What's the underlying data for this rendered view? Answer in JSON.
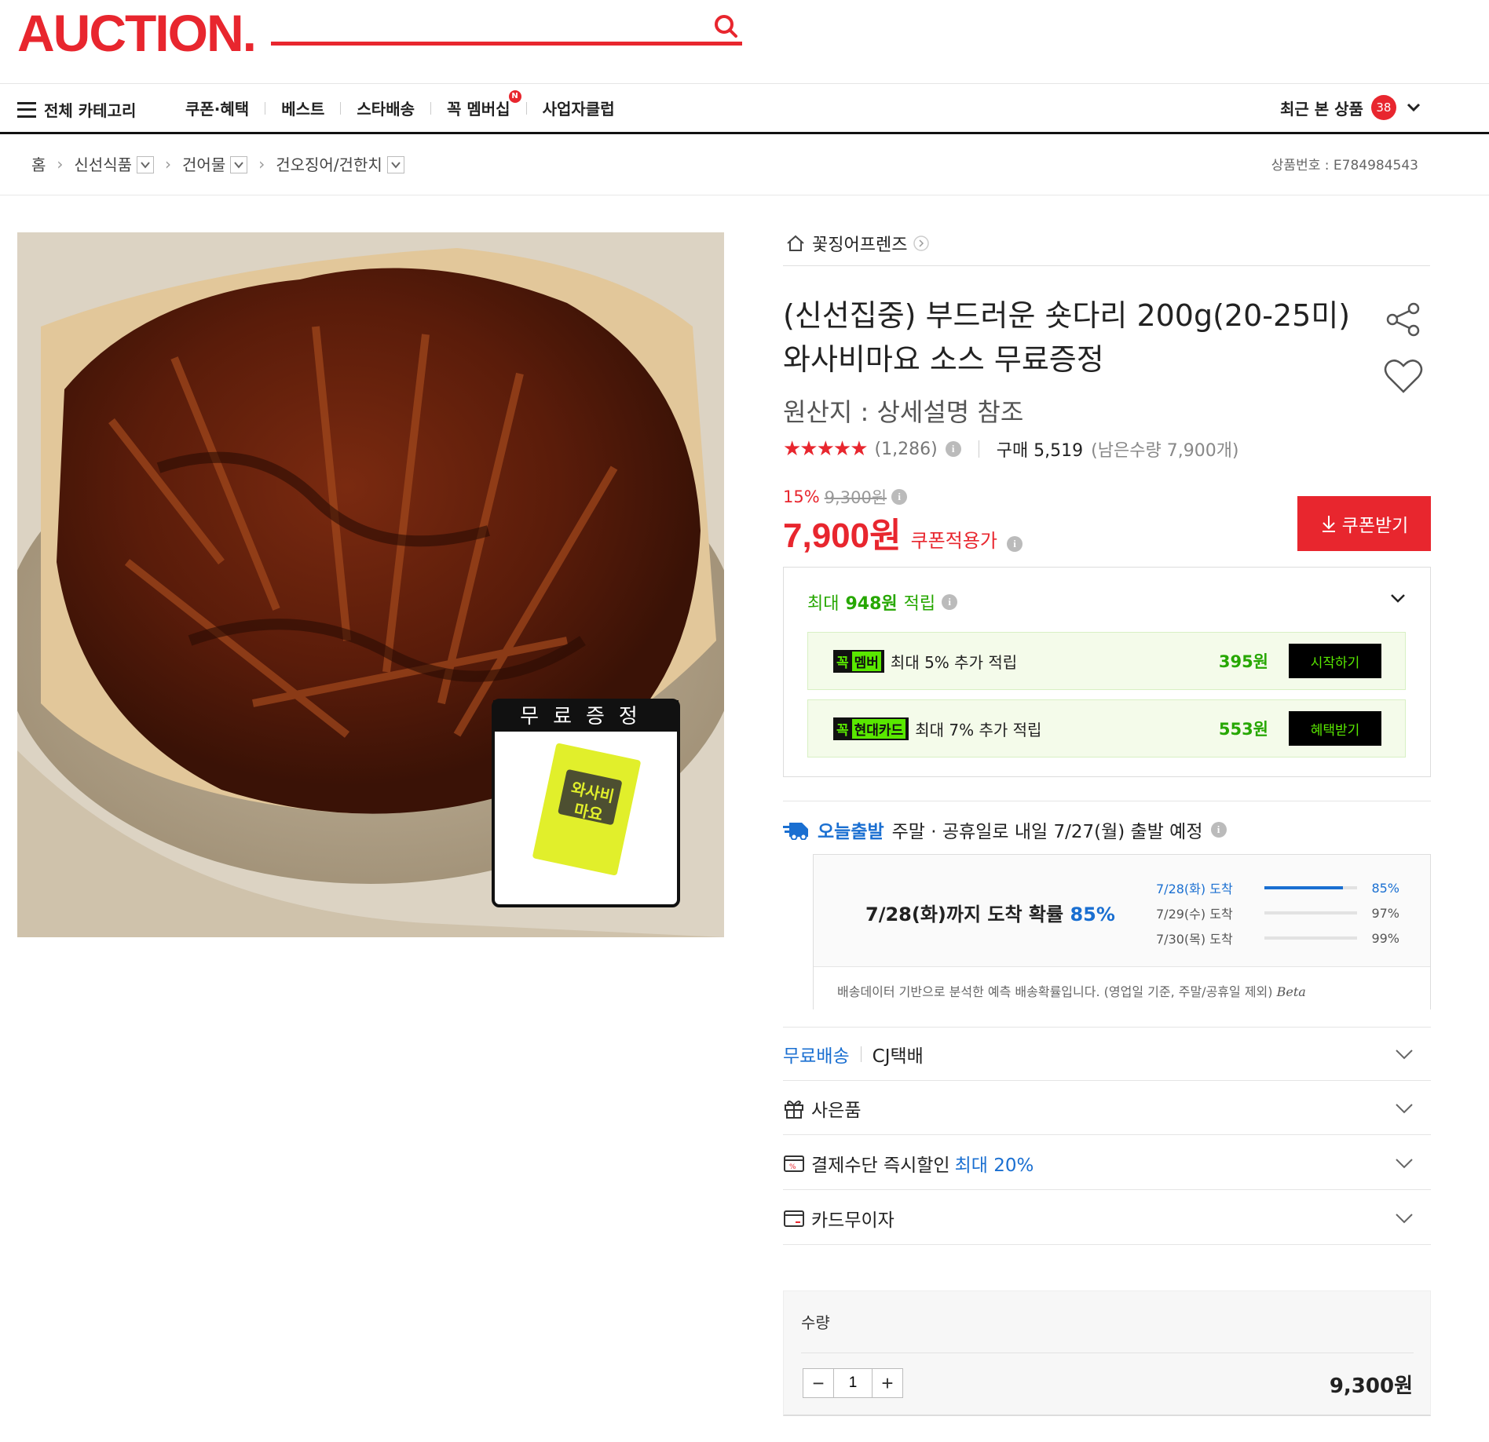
{
  "header": {
    "logo": "AUCTION.",
    "search_placeholder": "",
    "nav": {
      "all_categories": "전체 카테고리",
      "items": [
        "쿠폰·혜택",
        "베스트",
        "스타배송",
        "꼭 멤버십",
        "사업자클럽"
      ],
      "membership_badge": "N",
      "recent_label": "최근 본 상품",
      "recent_count": "38"
    }
  },
  "breadcrumb": {
    "home": "홈",
    "levels": [
      "신선식품",
      "건어물",
      "건오징어/건한치"
    ],
    "product_no_label": "상품번호 :",
    "product_no": "E784984543"
  },
  "product": {
    "image_overlay_title": "무료증정",
    "image_sticker_text": "와사비 마요",
    "seller": "꽃징어프렌즈",
    "title": "(신선집중) 부드러운 숏다리 200g(20-25미) 와사비마요 소스 무료증정",
    "origin": "원산지 : 상세설명 참조",
    "rating": 4.5,
    "stars": "★★★★★",
    "review_count": "(1,286)",
    "purchase": "구매 5,519",
    "remaining": "(남은수량 7,900개)",
    "discount_pct": "15%",
    "original_price": "9,300원",
    "price": "7,900원",
    "price_note": "쿠폰적용가",
    "coupon_button": "쿠폰받기"
  },
  "points": {
    "head_prefix": "최대 ",
    "head_amount": "948원",
    "head_suffix": " 적립",
    "rows": [
      {
        "tag_k": "꼭",
        "tag": "멤버",
        "desc": "최대 5% 추가 적립",
        "amount": "395원",
        "button": "시작하기"
      },
      {
        "tag_k": "꼭",
        "tag": "현대카드",
        "desc": "최대 7% 추가 적립",
        "amount": "553원",
        "button": "혜택받기"
      }
    ]
  },
  "shipping": {
    "today": "오늘출발",
    "text": "주말 · 공휴일로 내일 7/27(월) 출발 예정",
    "arrive_main": "7/28(화)까지 도착 확률 ",
    "arrive_pct": "85%",
    "rows": [
      {
        "label": "7/28(화) 도착",
        "pct": 0.85,
        "value": "85%"
      },
      {
        "label": "7/29(수) 도착",
        "pct": 0.97,
        "value": "97%"
      },
      {
        "label": "7/30(목) 도착",
        "pct": 0.99,
        "value": "99%"
      }
    ],
    "footnote": "배송데이터 기반으로 분석한 예측 배송확률입니다. (영업일 기준, 주말/공휴일 제외)",
    "beta": "Beta"
  },
  "accordions": {
    "delivery_free": "무료배송",
    "delivery_carrier": "CJ택배",
    "gift": "사은품",
    "payment_discount": "결제수단 즉시할인 ",
    "payment_discount_max": "최대 20%",
    "card_installment": "카드무이자"
  },
  "quantity": {
    "label": "수량",
    "value": "1",
    "total": "9,300원"
  }
}
